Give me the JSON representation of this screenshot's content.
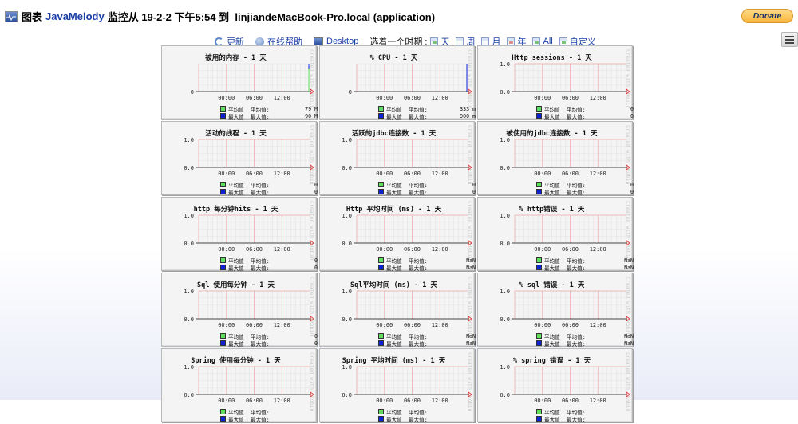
{
  "header": {
    "icon": "monitor-chart-icon",
    "prefix": "图表",
    "brand": "JavaMelody",
    "title_rest": "监控从 19-2-2 下午5:54 到_linjiandeMacBook-Pro.local (application)"
  },
  "donate_label": "Donate",
  "menu_icon": "hamburger-menu-icon",
  "toolbar": {
    "refresh": "更新",
    "help": "在线帮助",
    "desktop": "Desktop",
    "period_label": "选着一个时期 :",
    "periods": [
      {
        "label": "天",
        "icon": "calendar-day-icon"
      },
      {
        "label": "周",
        "icon": "calendar-week-icon"
      },
      {
        "label": "月",
        "icon": "calendar-month-icon"
      },
      {
        "label": "年",
        "icon": "calendar-year-icon"
      },
      {
        "label": "All",
        "icon": "calendar-all-icon"
      },
      {
        "label": "自定义",
        "icon": "calendar-custom-icon"
      }
    ]
  },
  "legend": {
    "avg_label": "平均值",
    "max_label": "最大值",
    "avg_colon": "平均值:",
    "max_colon": "最大值:",
    "avg_color": "#5ee05e",
    "max_color": "#0b22d6"
  },
  "watermark": "Created with JRobin",
  "chart_data": [
    {
      "type": "line",
      "title": "被用的内存 - 1 天",
      "y_ticks": [
        "0"
      ],
      "x_ticks": [
        "00:00",
        "06:00",
        "12:00"
      ],
      "avg": "79 M",
      "max": "90 M",
      "spike": "both"
    },
    {
      "type": "line",
      "title": "% CPU - 1 天",
      "y_ticks": [
        "0"
      ],
      "x_ticks": [
        "00:00",
        "06:00",
        "12:00"
      ],
      "avg": "333 m",
      "max": "900 m",
      "spike": "max"
    },
    {
      "type": "line",
      "title": "Http sessions - 1 天",
      "y_ticks": [
        "1.0",
        "0.0"
      ],
      "x_ticks": [
        "00:00",
        "06:00",
        "12:00"
      ],
      "avg": "0",
      "max": "0",
      "spike": "none"
    },
    {
      "type": "line",
      "title": "活动的线程 - 1 天",
      "y_ticks": [
        "1.0",
        "0.0"
      ],
      "x_ticks": [
        "00:00",
        "06:00",
        "12:00"
      ],
      "avg": "0",
      "max": "0",
      "spike": "none"
    },
    {
      "type": "line",
      "title": "活跃的jdbc连接数 - 1 天",
      "y_ticks": [
        "1.0",
        "0.0"
      ],
      "x_ticks": [
        "00:00",
        "06:00",
        "12:00"
      ],
      "avg": "0",
      "max": "0",
      "spike": "none"
    },
    {
      "type": "line",
      "title": "被使用的jdbc连接数 - 1 天",
      "y_ticks": [
        "1.0",
        "0.0"
      ],
      "x_ticks": [
        "00:00",
        "06:00",
        "12:00"
      ],
      "avg": "0",
      "max": "0",
      "spike": "none"
    },
    {
      "type": "line",
      "title": "http 每分钟hits - 1 天",
      "y_ticks": [
        "1.0",
        "0.0"
      ],
      "x_ticks": [
        "00:00",
        "06:00",
        "12:00"
      ],
      "avg": "0",
      "max": "0",
      "spike": "none"
    },
    {
      "type": "line",
      "title": "Http 平均时间 (ms) - 1 天",
      "y_ticks": [
        "1.0",
        "0.0"
      ],
      "x_ticks": [
        "00:00",
        "06:00",
        "12:00"
      ],
      "avg": "NaN",
      "max": "NaN",
      "spike": "none"
    },
    {
      "type": "line",
      "title": "% http错误 - 1 天",
      "y_ticks": [
        "1.0",
        "0.0"
      ],
      "x_ticks": [
        "00:00",
        "06:00",
        "12:00"
      ],
      "avg": "NaN",
      "max": "NaN",
      "spike": "none"
    },
    {
      "type": "line",
      "title": "Sql 使用每分钟 - 1 天",
      "y_ticks": [
        "1.0",
        "0.0"
      ],
      "x_ticks": [
        "00:00",
        "06:00",
        "12:00"
      ],
      "avg": "0",
      "max": "0",
      "spike": "none"
    },
    {
      "type": "line",
      "title": "Sql平均时间 (ms) - 1 天",
      "y_ticks": [
        "1.0",
        "0.0"
      ],
      "x_ticks": [
        "00:00",
        "06:00",
        "12:00"
      ],
      "avg": "NaN",
      "max": "NaN",
      "spike": "none"
    },
    {
      "type": "line",
      "title": "% sql 错误 - 1 天",
      "y_ticks": [
        "1.0",
        "0.0"
      ],
      "x_ticks": [
        "00:00",
        "06:00",
        "12:00"
      ],
      "avg": "NaN",
      "max": "NaN",
      "spike": "none"
    },
    {
      "type": "line",
      "title": "Spring 使用每分钟 - 1 天",
      "y_ticks": [
        "1.0",
        "0.0"
      ],
      "x_ticks": [
        "00:00",
        "06:00",
        "12:00"
      ],
      "avg": "",
      "max": "",
      "spike": "none"
    },
    {
      "type": "line",
      "title": "Spring 平均时间 (ms) - 1 天",
      "y_ticks": [
        "1.0",
        "0.0"
      ],
      "x_ticks": [
        "00:00",
        "06:00",
        "12:00"
      ],
      "avg": "",
      "max": "",
      "spike": "none"
    },
    {
      "type": "line",
      "title": "% spring 错误 - 1 天",
      "y_ticks": [
        "1.0",
        "0.0"
      ],
      "x_ticks": [
        "00:00",
        "06:00",
        "12:00"
      ],
      "avg": "",
      "max": "",
      "spike": "none"
    }
  ]
}
